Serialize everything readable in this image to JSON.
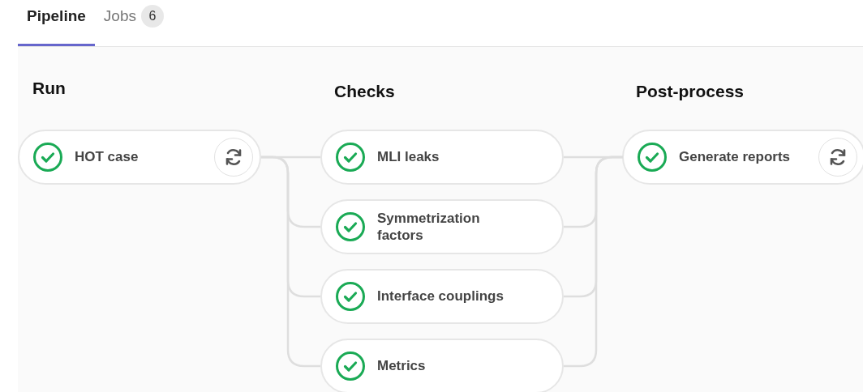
{
  "tabs": [
    {
      "label": "Pipeline",
      "selected": true
    },
    {
      "label": "Jobs",
      "count": "6",
      "selected": false
    }
  ],
  "stages": [
    {
      "title": "Run",
      "jobs": [
        {
          "name": "HOT case",
          "passed": true,
          "retry": true
        }
      ]
    },
    {
      "title": "Checks",
      "jobs": [
        {
          "name": "MLI leaks",
          "passed": true,
          "retry": false
        },
        {
          "name": "Symmetrization factors",
          "passed": true,
          "retry": false
        },
        {
          "name": "Interface couplings",
          "passed": true,
          "retry": false
        },
        {
          "name": "Metrics",
          "passed": true,
          "retry": false
        }
      ]
    },
    {
      "title": "Post-process",
      "jobs": [
        {
          "name": "Generate reports",
          "passed": true,
          "retry": true
        }
      ]
    }
  ]
}
